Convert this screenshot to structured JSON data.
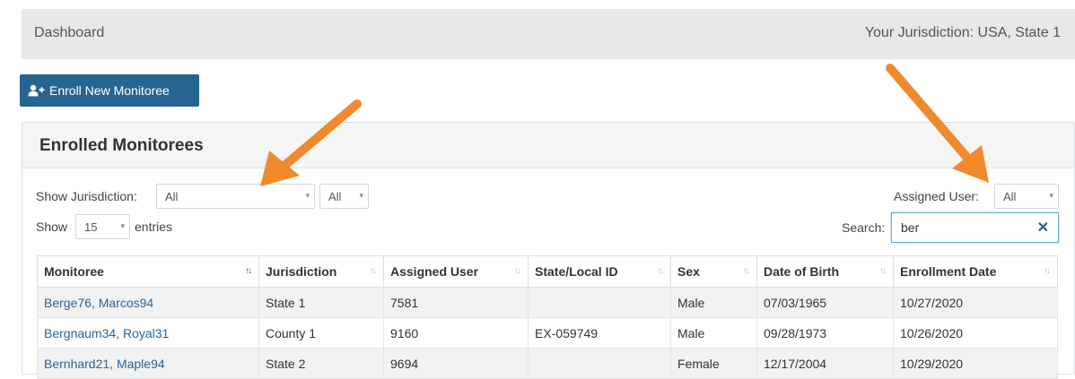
{
  "header": {
    "breadcrumb": "Dashboard",
    "jurisdiction": "Your Jurisdiction: USA, State 1"
  },
  "enroll_button": {
    "label": "Enroll New Monitoree",
    "icon": "user-plus-icon"
  },
  "panel": {
    "title": "Enrolled Monitorees"
  },
  "filters": {
    "show_jurisdiction_label": "Show Jurisdiction:",
    "jurisdiction_value": "All",
    "scope_value": "All",
    "assigned_user_label": "Assigned User:",
    "assigned_user_value": "All",
    "show_label": "Show",
    "entries_value": "15",
    "entries_label": "entries",
    "search_label": "Search:",
    "search_value": "ber"
  },
  "table": {
    "columns": [
      "Monitoree",
      "Jurisdiction",
      "Assigned User",
      "State/Local ID",
      "Sex",
      "Date of Birth",
      "Enrollment Date"
    ],
    "rows": [
      [
        "Berge76, Marcos94",
        "State 1",
        "7581",
        "",
        "Male",
        "07/03/1965",
        "10/27/2020"
      ],
      [
        "Bergnaum34, Royal31",
        "County 1",
        "9160",
        "EX-059749",
        "Male",
        "09/28/1973",
        "10/26/2020"
      ],
      [
        "Bernhard21, Maple94",
        "State 2",
        "9694",
        "",
        "Female",
        "12/17/2004",
        "10/29/2020"
      ]
    ]
  },
  "colors": {
    "accent": "#26658f",
    "link": "#2a6496",
    "annotation_arrow": "#f08a2c"
  }
}
